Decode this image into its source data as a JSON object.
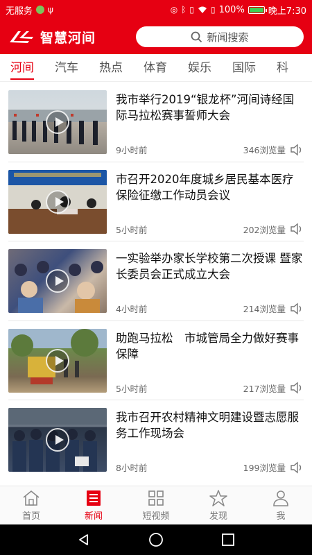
{
  "status_bar": {
    "carrier": "无服务",
    "battery_percent": "100%",
    "time": "晚上7:30",
    "battery_level": 1.0
  },
  "header": {
    "app_name": "智慧河间",
    "search_placeholder": "新闻搜索"
  },
  "tabs": [
    {
      "label": "河间",
      "active": true
    },
    {
      "label": "汽车",
      "active": false
    },
    {
      "label": "热点",
      "active": false
    },
    {
      "label": "体育",
      "active": false
    },
    {
      "label": "娱乐",
      "active": false
    },
    {
      "label": "国际",
      "active": false
    },
    {
      "label": "科",
      "active": false
    }
  ],
  "news": [
    {
      "title": "我市举行2019“银龙杯”河间诗经国际马拉松赛事誓师大会",
      "time": "9小时前",
      "views": "346浏览量"
    },
    {
      "title": "市召开2020年度城乡居民基本医疗保险征缴工作动员会议",
      "time": "5小时前",
      "views": "202浏览量"
    },
    {
      "title": "一实验举办家长学校第二次授课 暨家长委员会正式成立大会",
      "time": "4小时前",
      "views": "214浏览量"
    },
    {
      "title": "助跑马拉松　市城管局全力做好赛事保障",
      "time": "5小时前",
      "views": "217浏览量"
    },
    {
      "title": "我市召开农村精神文明建设暨志愿服务工作现场会",
      "time": "8小时前",
      "views": "199浏览量"
    }
  ],
  "bottom_nav": [
    {
      "label": "首页",
      "icon": "home-icon",
      "active": false
    },
    {
      "label": "新闻",
      "icon": "news-icon",
      "active": true
    },
    {
      "label": "短视频",
      "icon": "grid-icon",
      "active": false
    },
    {
      "label": "发现",
      "icon": "star-icon",
      "active": false
    },
    {
      "label": "我",
      "icon": "user-icon",
      "active": false
    }
  ],
  "colors": {
    "brand": "#e60012",
    "text": "#111111",
    "meta": "#666666"
  }
}
